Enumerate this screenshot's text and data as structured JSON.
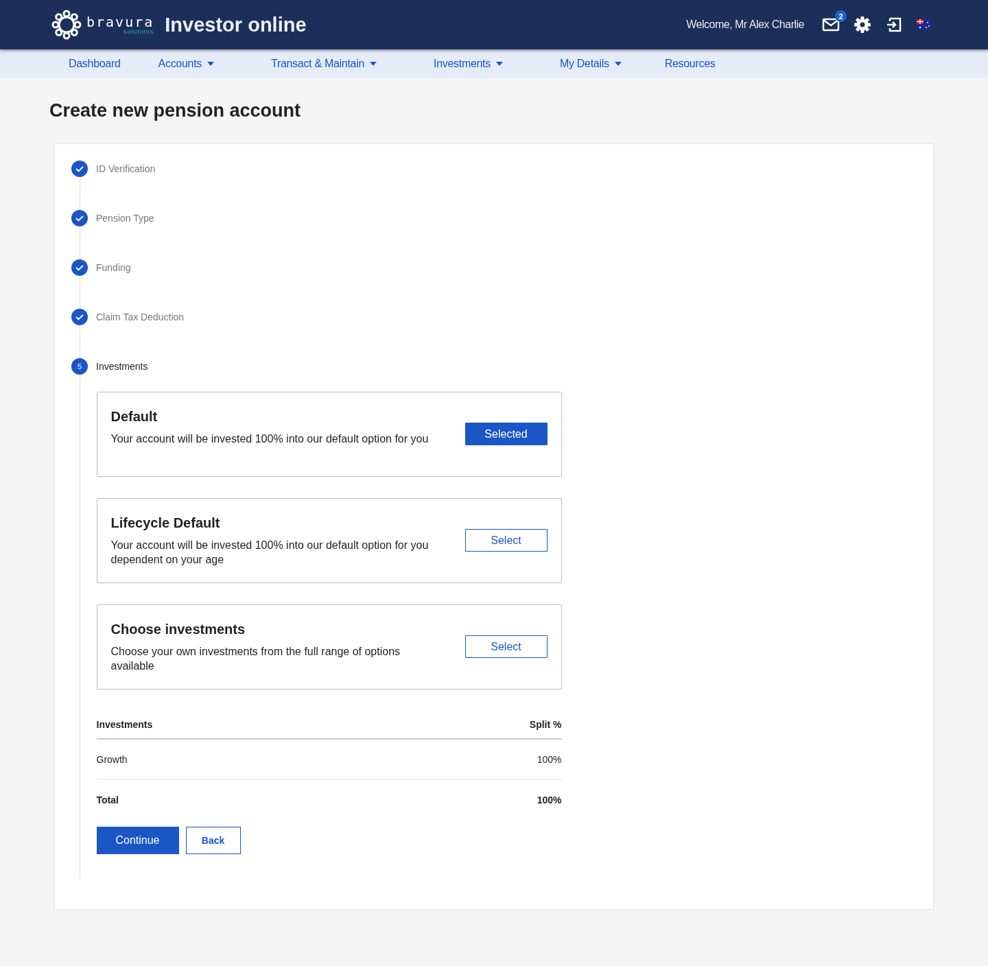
{
  "header": {
    "brand": "bravura",
    "brand_sub": "solutions",
    "app_title": "Investor online",
    "welcome": "Welcome, Mr Alex Charlie",
    "mail_badge": "2"
  },
  "nav": [
    {
      "label": "Dashboard",
      "dropdown": false
    },
    {
      "label": "Accounts",
      "dropdown": true
    },
    {
      "label": "Transact & Maintain",
      "dropdown": true
    },
    {
      "label": "Investments",
      "dropdown": true
    },
    {
      "label": "My Details",
      "dropdown": true
    },
    {
      "label": "Resources",
      "dropdown": false
    }
  ],
  "page_title": "Create new pension account",
  "steps": [
    {
      "label": "ID Verification",
      "completed": true
    },
    {
      "label": "Pension Type",
      "completed": true
    },
    {
      "label": "Funding",
      "completed": true
    },
    {
      "label": "Claim Tax Deduction",
      "completed": true
    },
    {
      "label": "Investments",
      "completed": false,
      "number": "5"
    }
  ],
  "options": [
    {
      "title": "Default",
      "description": "Your account will be invested 100% into our default option for you",
      "selected": true,
      "button": "Selected"
    },
    {
      "title": "Lifecycle Default",
      "description": "Your account will be invested 100% into our default option for you dependent on your age",
      "selected": false,
      "button": "Select"
    },
    {
      "title": "Choose investments",
      "description": "Choose your own investments from the full range of options available",
      "selected": false,
      "button": "Select"
    }
  ],
  "table": {
    "columns": [
      "Investments",
      "Split %"
    ],
    "rows": [
      [
        "Growth",
        "100%"
      ]
    ],
    "total": [
      "Total",
      "100%"
    ]
  },
  "buttons": {
    "continue": "Continue",
    "back": "Back"
  }
}
